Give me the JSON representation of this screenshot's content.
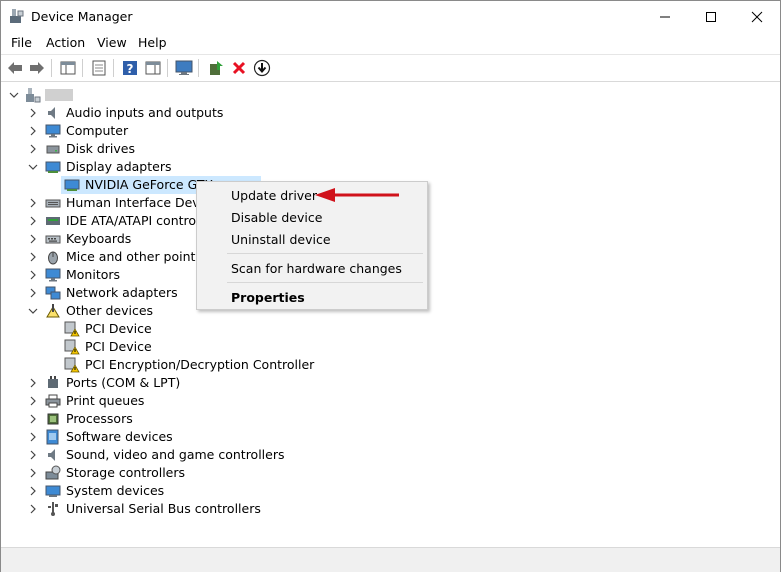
{
  "window": {
    "title": "Device Manager"
  },
  "menu": [
    "File",
    "Action",
    "View",
    "Help"
  ],
  "tree": {
    "root_label": "",
    "items": [
      {
        "label": "Audio inputs and outputs",
        "icon": "speaker-icon"
      },
      {
        "label": "Computer",
        "icon": "monitor-icon"
      },
      {
        "label": "Disk drives",
        "icon": "disk-drive-icon"
      },
      {
        "label": "Display adapters",
        "icon": "display-adapter-icon",
        "expanded": true
      },
      {
        "label": "NVIDIA GeForce GTX",
        "icon": "display-adapter-icon",
        "child": true,
        "selected": true
      },
      {
        "label": "Human Interface Devices",
        "icon": "hid-icon"
      },
      {
        "label": "IDE ATA/ATAPI controller",
        "icon": "ide-controller-icon"
      },
      {
        "label": "Keyboards",
        "icon": "keyboard-icon"
      },
      {
        "label": "Mice and other pointing",
        "icon": "mouse-icon"
      },
      {
        "label": "Monitors",
        "icon": "monitor-icon"
      },
      {
        "label": "Network adapters",
        "icon": "network-icon"
      },
      {
        "label": "Other devices",
        "icon": "other-devices-icon",
        "expanded": true
      },
      {
        "label": "PCI Device",
        "icon": "warning-device-icon",
        "child": true
      },
      {
        "label": "PCI Device",
        "icon": "warning-device-icon",
        "child": true
      },
      {
        "label": "PCI Encryption/Decryption Controller",
        "icon": "warning-device-icon",
        "child": true
      },
      {
        "label": "Ports (COM & LPT)",
        "icon": "port-icon"
      },
      {
        "label": "Print queues",
        "icon": "printer-icon"
      },
      {
        "label": "Processors",
        "icon": "processor-icon"
      },
      {
        "label": "Software devices",
        "icon": "software-device-icon"
      },
      {
        "label": "Sound, video and game controllers",
        "icon": "speaker-icon"
      },
      {
        "label": "Storage controllers",
        "icon": "storage-icon"
      },
      {
        "label": "System devices",
        "icon": "system-icon"
      },
      {
        "label": "Universal Serial Bus controllers",
        "icon": "usb-icon"
      }
    ]
  },
  "context_menu": {
    "update": "Update driver",
    "disable": "Disable device",
    "uninstall": "Uninstall device",
    "scan": "Scan for hardware changes",
    "properties": "Properties"
  },
  "colors": {
    "selection": "#cce8ff",
    "arrow": "#d0121b",
    "disable_x": "#e81123"
  }
}
